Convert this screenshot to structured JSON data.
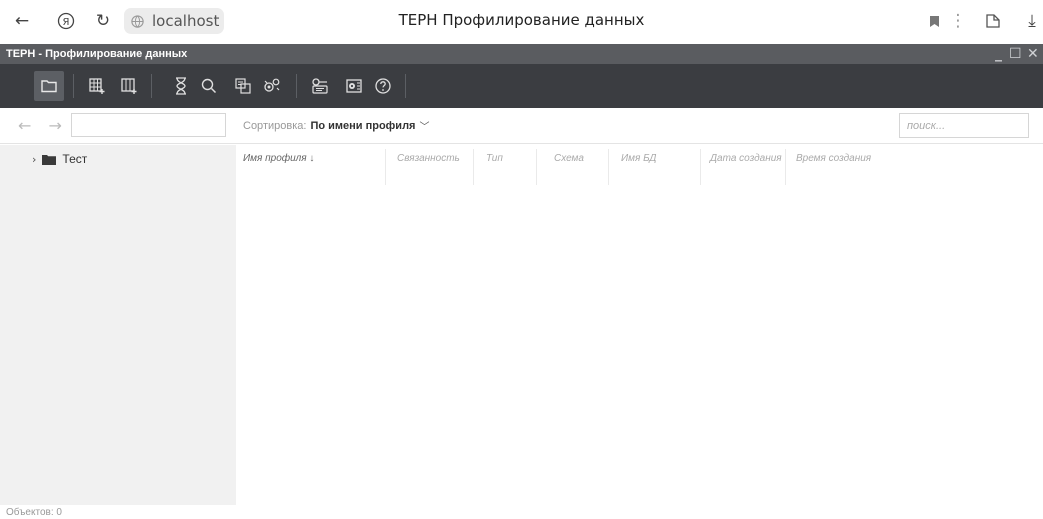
{
  "browser": {
    "url": "localhost",
    "tab_title": "ТЕРН Профилирование данных"
  },
  "window": {
    "title": "ТЕРН - Профилирование данных"
  },
  "toolbar": {
    "buttons": [
      "folder-icon",
      "add-table-icon",
      "add-column-icon",
      "hourglass-icon",
      "search-icon",
      "copy-icon",
      "settings-gears-icon",
      "key-icon",
      "config-icon",
      "help-icon"
    ]
  },
  "navbar": {
    "nav_arrows": "← →",
    "path_value": "",
    "sort_label": "Сортировка:",
    "sort_value": "По имени профиля",
    "search_placeholder": "поиск..."
  },
  "tree": {
    "items": [
      {
        "label": "Тест"
      }
    ]
  },
  "table": {
    "columns": [
      "Имя профиля ↓",
      "Связанность",
      "Тип",
      "Схема",
      "Имя БД",
      "Дата создания",
      "Время создания"
    ],
    "rows": []
  },
  "status": {
    "text": "Объектов: 0"
  },
  "colors": {
    "titlebar": "#5a5c60",
    "toolbar": "#3b3d41",
    "sidebar": "#f1f1f1"
  }
}
